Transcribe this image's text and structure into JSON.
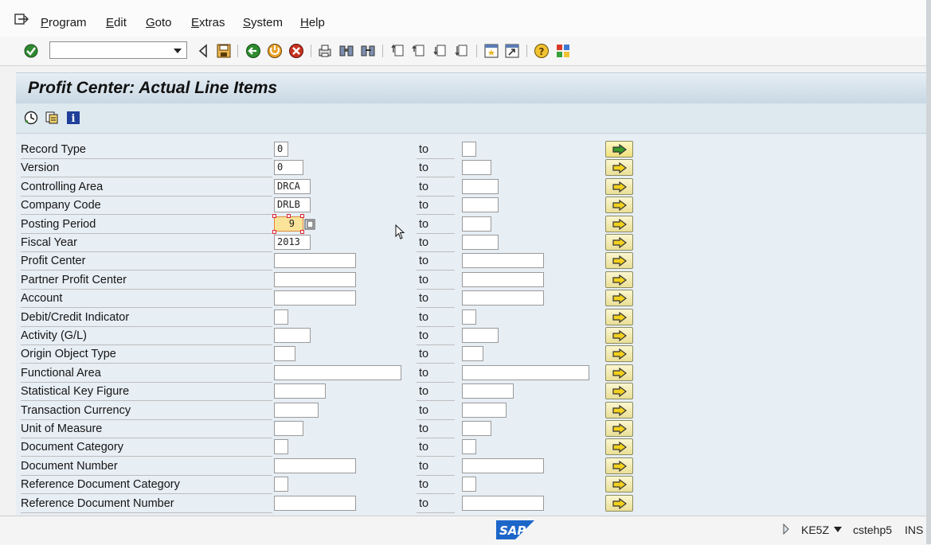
{
  "menu": [
    "Program",
    "Edit",
    "Goto",
    "Extras",
    "System",
    "Help"
  ],
  "toolbar": {
    "command_value": ""
  },
  "title": "Profit Center: Actual Line Items",
  "to_label": "to",
  "fields": [
    {
      "label": "Record Type",
      "from": "0",
      "to": ""
    },
    {
      "label": "Version",
      "from": "0",
      "to": ""
    },
    {
      "label": "Controlling Area",
      "from": "DRCA",
      "to": ""
    },
    {
      "label": "Company Code",
      "from": "DRLB",
      "to": ""
    },
    {
      "label": "Posting Period",
      "from": "9",
      "to": ""
    },
    {
      "label": "Fiscal Year",
      "from": "2013",
      "to": ""
    },
    {
      "label": "Profit Center",
      "from": "",
      "to": ""
    },
    {
      "label": "Partner Profit Center",
      "from": "",
      "to": ""
    },
    {
      "label": "Account",
      "from": "",
      "to": ""
    },
    {
      "label": "Debit/Credit Indicator",
      "from": "",
      "to": ""
    },
    {
      "label": "Activity (G/L)",
      "from": "",
      "to": ""
    },
    {
      "label": "Origin Object Type",
      "from": "",
      "to": ""
    },
    {
      "label": "Functional Area",
      "from": "",
      "to": ""
    },
    {
      "label": "Statistical Key Figure",
      "from": "",
      "to": ""
    },
    {
      "label": "Transaction Currency",
      "from": "",
      "to": ""
    },
    {
      "label": "Unit of Measure",
      "from": "",
      "to": ""
    },
    {
      "label": "Document Category",
      "from": "",
      "to": ""
    },
    {
      "label": "Document Number",
      "from": "",
      "to": ""
    },
    {
      "label": "Reference Document Category",
      "from": "",
      "to": ""
    },
    {
      "label": "Reference Document Number",
      "from": "",
      "to": ""
    }
  ],
  "status": {
    "logo": "SAP",
    "transaction": "KE5Z",
    "server": "cstehp5",
    "mode": "INS"
  },
  "colors": {
    "accent": "#f0e07c",
    "title_bg": "#c9d8e4",
    "form_bg": "#e7eef4",
    "active_field": "#fbe39a"
  }
}
